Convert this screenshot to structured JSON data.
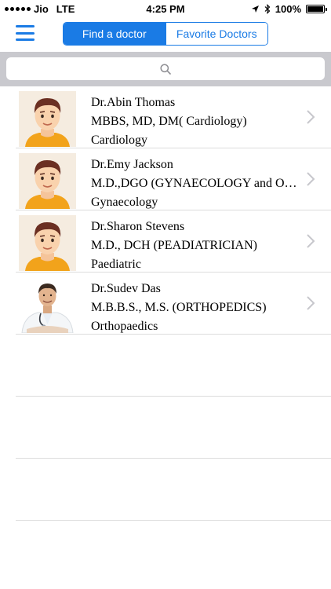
{
  "status": {
    "carrier": "Jio",
    "network": "LTE",
    "time": "4:25 PM",
    "battery": "100%",
    "battery_level": 1.0
  },
  "nav": {
    "tabs": [
      {
        "label": "Find a doctor",
        "active": true
      },
      {
        "label": "Favorite Doctors",
        "active": false
      }
    ]
  },
  "doctors": [
    {
      "name": "Dr.Abin Thomas",
      "degree": "MBBS, MD, DM( Cardiology)",
      "specialty": "Cardiology",
      "avatar": "cartoon-man-icon"
    },
    {
      "name": "Dr.Emy Jackson",
      "degree": "M.D.,DGO (GYNAECOLOGY  and OBSTETRICS)",
      "specialty": "Gynaecology",
      "avatar": "cartoon-man-icon"
    },
    {
      "name": "Dr.Sharon Stevens",
      "degree": "M.D., DCH (PEADIATRICIAN)",
      "specialty": "Paediatric",
      "avatar": "cartoon-man-icon"
    },
    {
      "name": "Dr.Sudev Das",
      "degree": "M.B.B.S., M.S. (ORTHOPEDICS)",
      "specialty": "Orthopaedics",
      "avatar": "doctor-photo"
    }
  ],
  "colors": {
    "accent": "#1a7be5",
    "search_bar_bg": "#c9c9ce",
    "separator": "#dcdcdc"
  }
}
